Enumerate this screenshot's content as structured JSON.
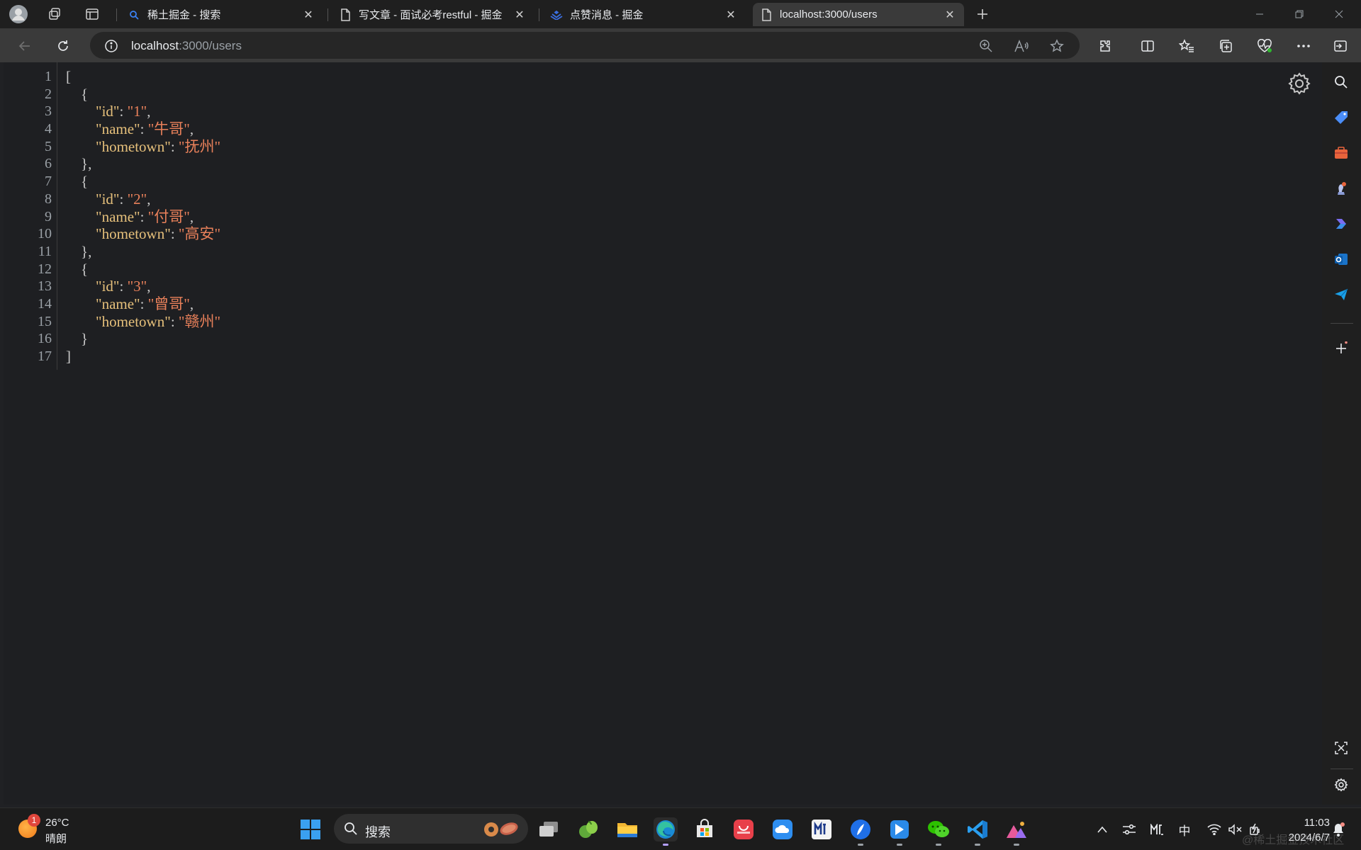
{
  "browser": {
    "tabs": [
      {
        "title": "稀土掘金 - 搜索",
        "icon": "search-favicon",
        "active": false
      },
      {
        "title": "写文章 - 面试必考restful - 掘金",
        "icon": "page-favicon",
        "active": false
      },
      {
        "title": "点赞消息 - 掘金",
        "icon": "juejin-favicon",
        "active": false
      },
      {
        "title": "localhost:3000/users",
        "icon": "page-favicon",
        "active": true
      }
    ],
    "address": {
      "host": "localhost",
      "path": ":3000/users"
    }
  },
  "json_viewer": {
    "line_numbers": [
      "1",
      "2",
      "3",
      "4",
      "5",
      "6",
      "7",
      "8",
      "9",
      "10",
      "11",
      "12",
      "13",
      "14",
      "15",
      "16",
      "17"
    ],
    "users": [
      {
        "id": "1",
        "name": "牛哥",
        "hometown": "抚州"
      },
      {
        "id": "2",
        "name": "付哥",
        "hometown": "高安"
      },
      {
        "id": "3",
        "name": "曾哥",
        "hometown": "赣州"
      }
    ],
    "keys": {
      "id": "\"id\"",
      "name": "\"name\"",
      "hometown": "\"hometown\""
    }
  },
  "taskbar": {
    "weather": {
      "temp": "26°C",
      "desc": "晴朗",
      "badge": "1"
    },
    "search_label": "搜索",
    "ime": "中",
    "clock": {
      "time": "11:03",
      "date": "2024/6/7"
    }
  },
  "watermark": "@稀土掘金技术社区",
  "colors": {
    "json_key": "#e6c07b",
    "json_string": "#e8805a",
    "background": "#1e1f22"
  }
}
